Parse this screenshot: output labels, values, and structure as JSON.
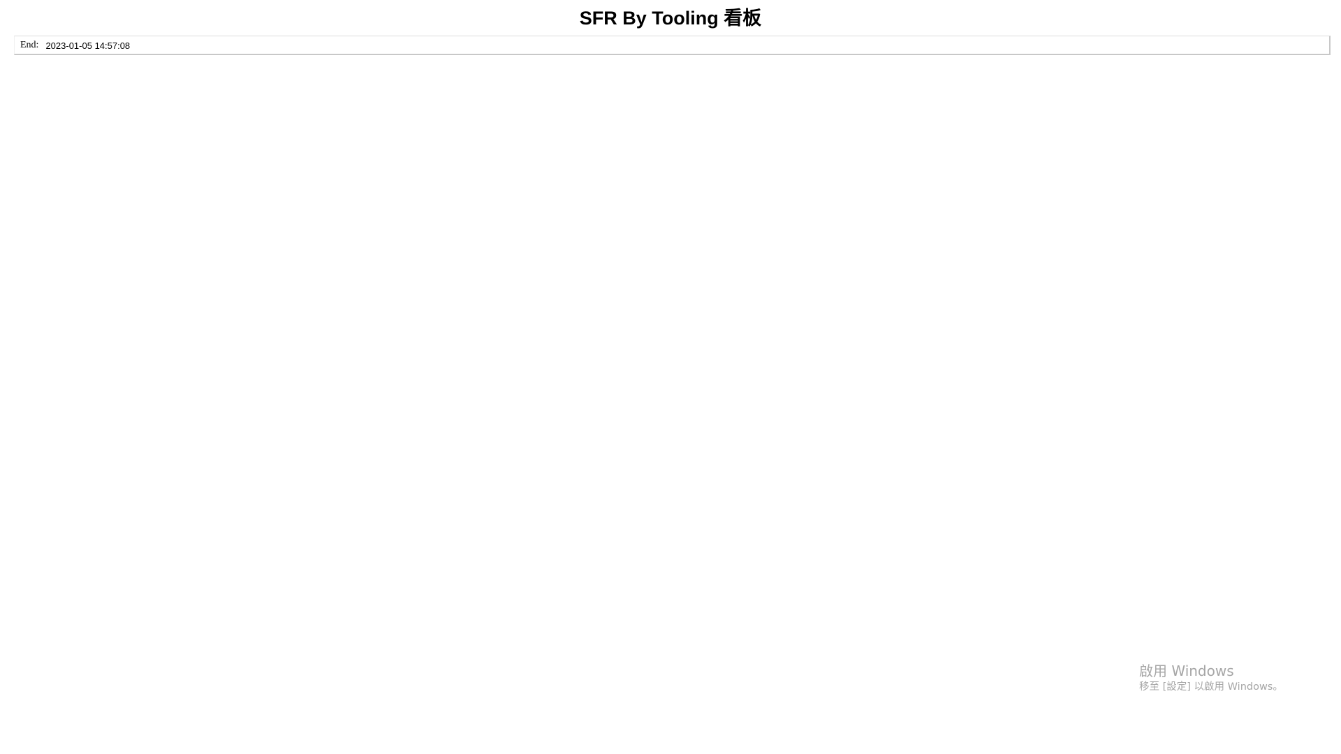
{
  "page": {
    "title": "SFR By Tooling 看板"
  },
  "filter": {
    "end_label": "End:",
    "end_value": "2023-01-05 14:57:08"
  },
  "watermark": {
    "title": "啟用 Windows",
    "subtitle": "移至 [設定] 以啟用 Windows。"
  }
}
